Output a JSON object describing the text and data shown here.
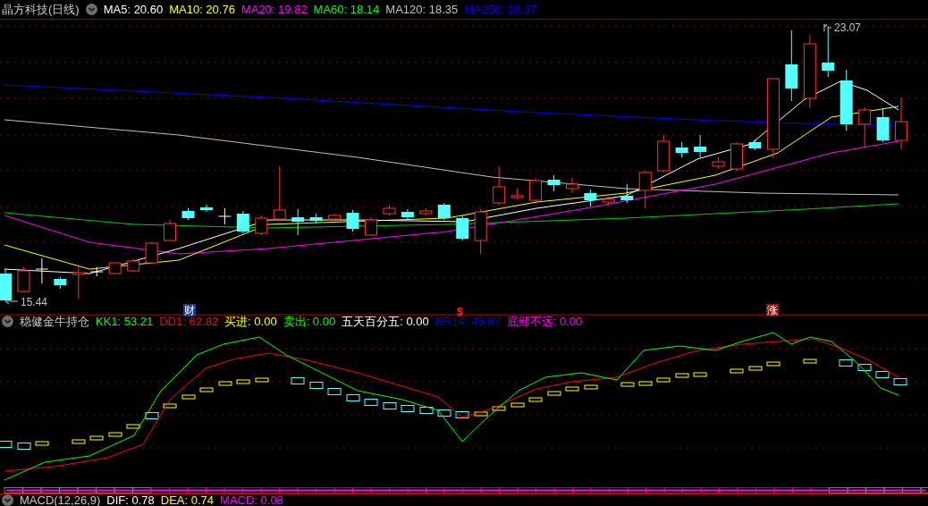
{
  "header": {
    "title": "晶方科技(日线)",
    "ma_values": [
      {
        "text": "MA5: 20.60",
        "color": "#ffffff"
      },
      {
        "text": "MA10: 20.76",
        "color": "#ffff00"
      },
      {
        "text": "MA20: 19.82",
        "color": "#ff00ff"
      },
      {
        "text": "MA60: 18.14",
        "color": "#00ff00"
      },
      {
        "text": "MA120: 18.35",
        "color": "#c0c0c0"
      },
      {
        "text": "MA250: 20.37",
        "color": "#0000ff"
      }
    ]
  },
  "price_chart": {
    "high_label": "23.07",
    "low_label": "15.44",
    "markers": [
      {
        "kind": "finance",
        "text": "财"
      },
      {
        "kind": "dollar",
        "text": "$"
      },
      {
        "kind": "rise",
        "text": "涨"
      }
    ]
  },
  "indicator": {
    "title": "稳健金牛持仓",
    "values": [
      {
        "text": "KK1: 53.21",
        "color": "#00ff00"
      },
      {
        "text": "DD1: 62.82",
        "color": "#ff0000"
      },
      {
        "text": "买进: 0.00",
        "color": "#ffff00"
      },
      {
        "text": "卖出: 0.00",
        "color": "#00ff00"
      },
      {
        "text": "五天百分五: 0.00",
        "color": "#ffffff"
      },
      {
        "text": "RR14: 45.87",
        "color": "#0000ff"
      },
      {
        "text": "底部不远: 0.00",
        "color": "#ff00ff"
      }
    ]
  },
  "macd": {
    "title": "MACD(12,26,9)",
    "values": [
      {
        "text": "DIF: 0.78",
        "color": "#ffffff"
      },
      {
        "text": "DEA: 0.74",
        "color": "#ffff00"
      },
      {
        "text": "MACD: 0.08",
        "color": "#ff00ff"
      }
    ]
  }
}
